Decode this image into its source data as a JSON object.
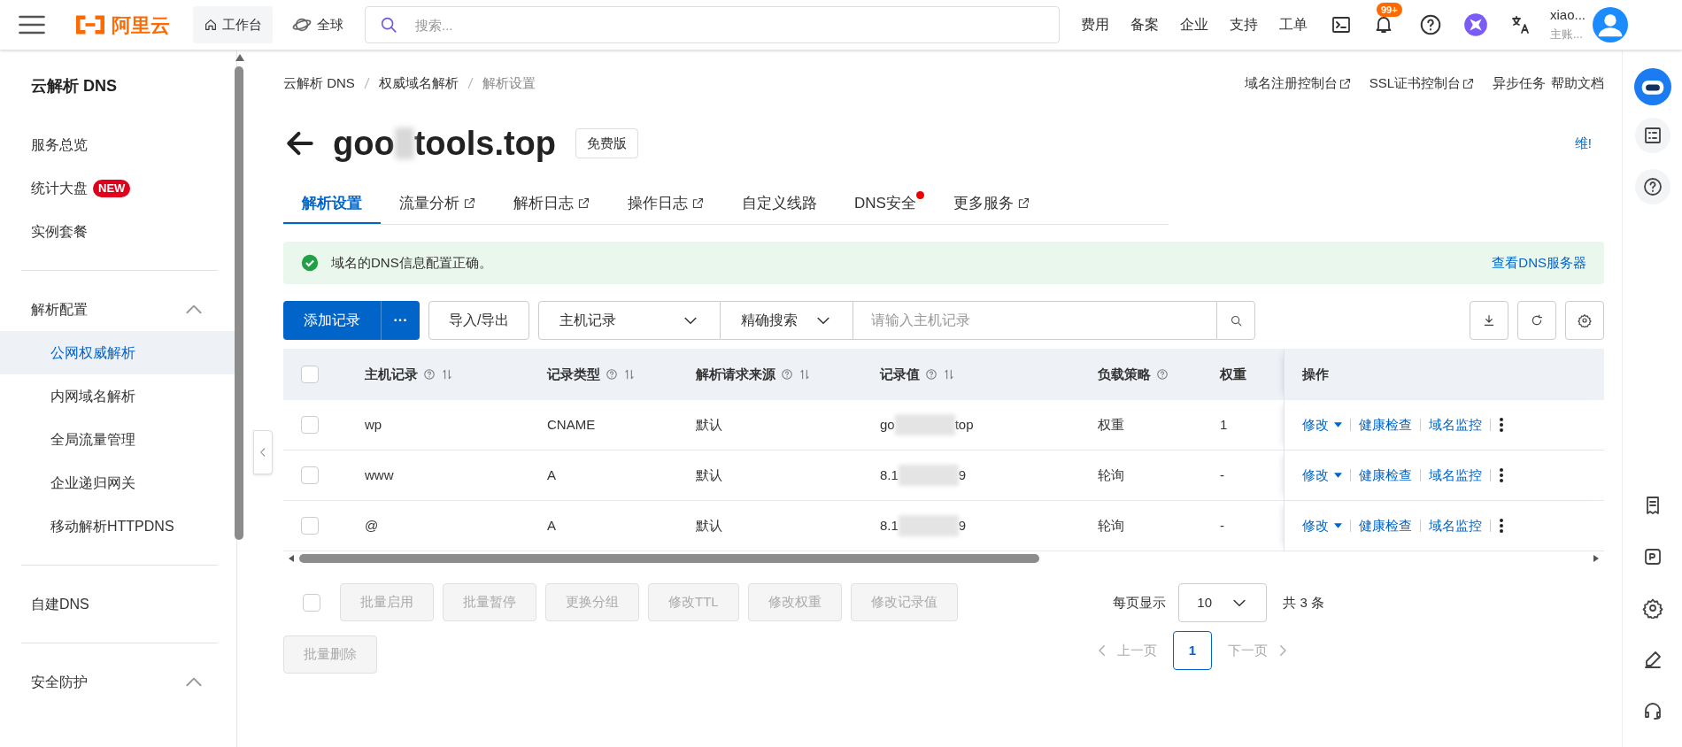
{
  "topbar": {
    "logo": "阿里云",
    "workbench": "工作台",
    "region": "全球",
    "search_placeholder": "搜索...",
    "links": [
      "费用",
      "备案",
      "企业",
      "支持",
      "工单"
    ],
    "notification_badge": "99+",
    "user_name": "xiao...",
    "user_role": "主账..."
  },
  "sidebar": {
    "title": "云解析 DNS",
    "sections": [
      {
        "items": [
          {
            "label": "服务总览",
            "selected": false
          },
          {
            "label": "统计大盘",
            "badge": "NEW",
            "selected": false
          },
          {
            "label": "实例套餐",
            "selected": false
          }
        ]
      },
      {
        "title": "解析配置",
        "expanded": true,
        "items": [
          {
            "label": "公网权威解析",
            "selected": true
          },
          {
            "label": "内网域名解析",
            "selected": false
          },
          {
            "label": "全局流量管理",
            "selected": false
          },
          {
            "label": "企业递归网关",
            "selected": false
          },
          {
            "label": "移动解析HTTPDNS",
            "selected": false
          }
        ]
      },
      {
        "items": [
          {
            "label": "自建DNS",
            "selected": false
          }
        ]
      },
      {
        "title": "安全防护",
        "expanded": true
      }
    ]
  },
  "breadcrumb": [
    "云解析 DNS",
    "权威域名解析",
    "解析设置"
  ],
  "header_links": [
    {
      "label": "域名注册控制台",
      "external": true
    },
    {
      "label": "SSL证书控制台",
      "external": true
    },
    {
      "label": "异步任务",
      "external": false
    },
    {
      "label": "帮助文档",
      "external": false
    }
  ],
  "domain": {
    "visible_start": "goo",
    "visible_end": "tools.top",
    "edition": "免费版",
    "side_link": "维!"
  },
  "tabs": [
    {
      "label": "解析设置",
      "selected": true,
      "external": false,
      "dot": false
    },
    {
      "label": "流量分析",
      "selected": false,
      "external": true,
      "dot": false
    },
    {
      "label": "解析日志",
      "selected": false,
      "external": true,
      "dot": false
    },
    {
      "label": "操作日志",
      "selected": false,
      "external": true,
      "dot": false
    },
    {
      "label": "自定义线路",
      "selected": false,
      "external": false,
      "dot": false
    },
    {
      "label": "DNS安全",
      "selected": false,
      "external": false,
      "dot": true
    },
    {
      "label": "更多服务",
      "selected": false,
      "external": true,
      "dot": false
    }
  ],
  "alert": {
    "message": "域名的DNS信息配置正确。",
    "link": "查看DNS服务器"
  },
  "toolbar": {
    "add": "添加记录",
    "more": "···",
    "import_export": "导入/导出",
    "field_select": "主机记录",
    "match_select": "精确搜索",
    "search_placeholder": "请输入主机记录"
  },
  "table": {
    "select_all_checked": false,
    "columns": [
      {
        "label": "主机记录",
        "help": true,
        "sortable": true
      },
      {
        "label": "记录类型",
        "help": true,
        "sortable": true
      },
      {
        "label": "解析请求来源",
        "help": true,
        "sortable": true
      },
      {
        "label": "记录值",
        "help": true,
        "sortable": true
      },
      {
        "label": "负载策略",
        "help": true,
        "sortable": false
      },
      {
        "label": "权重",
        "help": false,
        "sortable": false
      },
      {
        "label": "操作",
        "help": false,
        "sortable": false
      }
    ],
    "rows": [
      {
        "checked": false,
        "host": "wp",
        "type": "CNAME",
        "source": "默认",
        "value_start": "go",
        "value_end": "top",
        "policy": "权重",
        "weight": "1",
        "actions": [
          "修改",
          "健康检查",
          "域名监控"
        ]
      },
      {
        "checked": false,
        "host": "www",
        "type": "A",
        "source": "默认",
        "value_start": "8.1",
        "value_end": "9",
        "policy": "轮询",
        "weight": "-",
        "actions": [
          "修改",
          "健康检查",
          "域名监控"
        ]
      },
      {
        "checked": false,
        "host": "@",
        "type": "A",
        "source": "默认",
        "value_start": "8.1",
        "value_end": "9",
        "policy": "轮询",
        "weight": "-",
        "actions": [
          "修改",
          "健康检查",
          "域名监控"
        ]
      }
    ]
  },
  "bulk_select_checked": false,
  "bulk_actions": [
    {
      "label": "批量启用",
      "disabled": true
    },
    {
      "label": "批量暂停",
      "disabled": true
    },
    {
      "label": "更换分组",
      "disabled": true
    },
    {
      "label": "修改TTL",
      "disabled": true
    },
    {
      "label": "修改权重",
      "disabled": true
    },
    {
      "label": "修改记录值",
      "disabled": true
    },
    {
      "label": "批量删除",
      "disabled": true
    }
  ],
  "pagination": {
    "page_size_label": "每页显示",
    "page_size": "10",
    "total": "共 3 条",
    "prev": "上一页",
    "pages": [
      {
        "label": "1",
        "selected": true
      }
    ],
    "next": "下一页"
  }
}
